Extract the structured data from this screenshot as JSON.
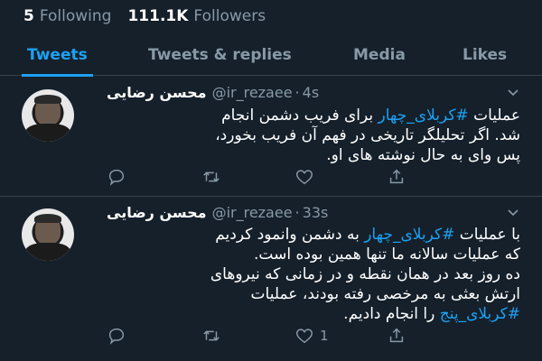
{
  "stats": {
    "following_count": "5",
    "following_label": "Following",
    "followers_count": "111.1K",
    "followers_label": "Followers"
  },
  "tabs": [
    {
      "label": "Tweets",
      "active": true
    },
    {
      "label": "Tweets & replies",
      "active": false
    },
    {
      "label": "Media",
      "active": false
    },
    {
      "label": "Likes",
      "active": false
    }
  ],
  "colors": {
    "accent": "#1da1f2",
    "background": "#15202b",
    "muted": "#8899a6",
    "divider": "#38444d"
  },
  "tweets": [
    {
      "name": "محسن رضایی",
      "handle": "@ir_rezaee",
      "time": "4s",
      "lines": [
        {
          "pre": "عملیات ",
          "tag": "#کربلای_چهار",
          "post": " برای فریب دشمن انجام"
        },
        {
          "pre": "شد. اگر تحلیلگر تاریخی  در فهم آن فریب بخورد،",
          "tag": "",
          "post": ""
        },
        {
          "pre": "پس وای به حال نوشته های او.",
          "tag": "",
          "post": ""
        }
      ],
      "reply_count": "",
      "retweet_count": "",
      "like_count": ""
    },
    {
      "name": "محسن رضایی",
      "handle": "@ir_rezaee",
      "time": "33s",
      "lines": [
        {
          "pre": "با عملیات ",
          "tag": "#کربلای_چهار",
          "post": " به دشمن وانمود کردیم"
        },
        {
          "pre": "که عملیات سالانه ما تنها همین بوده است.",
          "tag": "",
          "post": ""
        },
        {
          "pre": "ده روز بعد در همان نقطه و در زمانی که نیروهای",
          "tag": "",
          "post": ""
        },
        {
          "pre": "ارتش بعثی به مرخصی رفته بودند، عملیات",
          "tag": "",
          "post": ""
        },
        {
          "pre": "",
          "tag": "#کربلای_پنج",
          "post": " را انجام دادیم."
        }
      ],
      "reply_count": "",
      "retweet_count": "",
      "like_count": "1"
    }
  ],
  "icons": {
    "reply": "reply-icon",
    "retweet": "retweet-icon",
    "like": "heart-icon",
    "share": "share-icon",
    "caret": "chevron-down-icon"
  }
}
